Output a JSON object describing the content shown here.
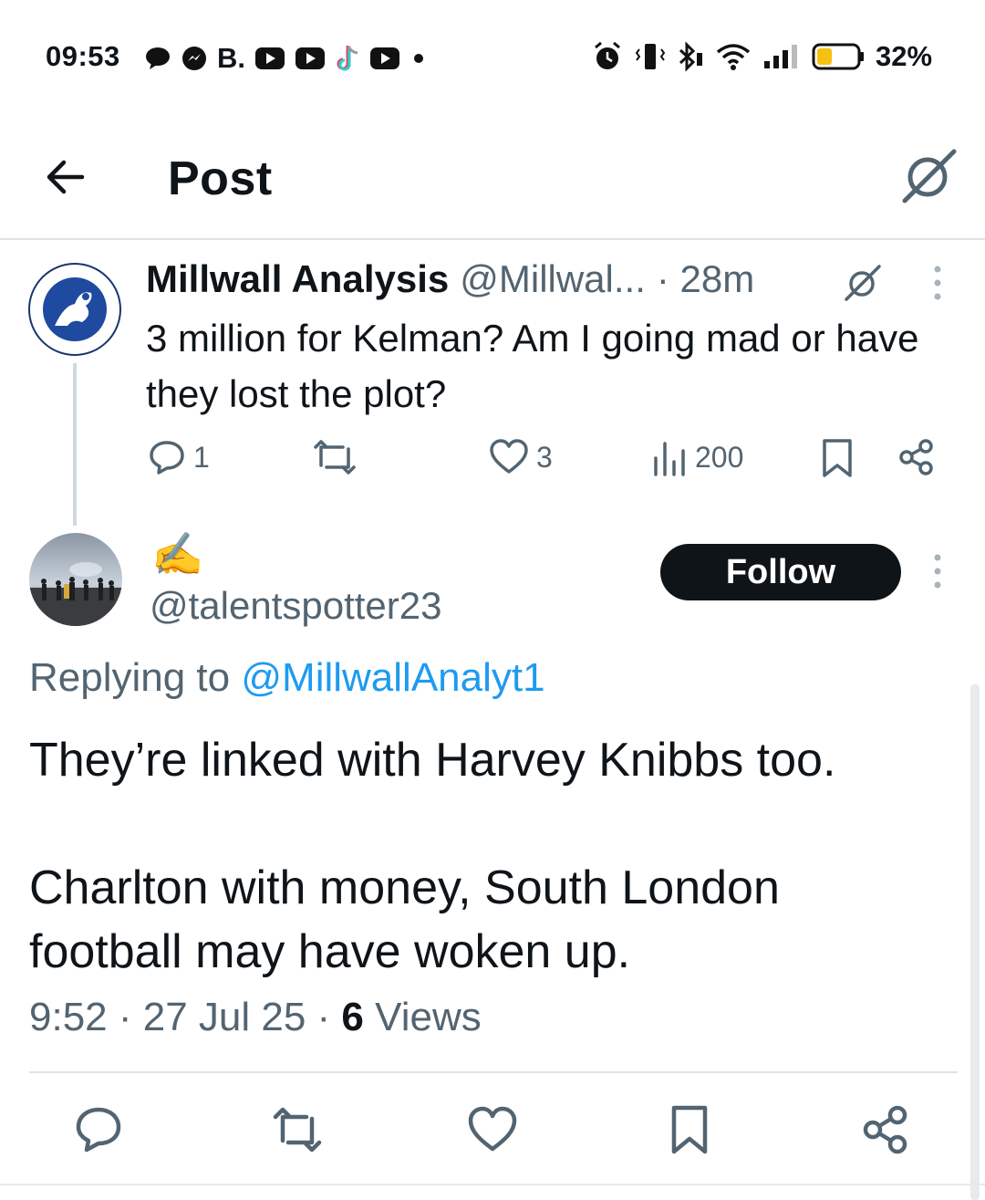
{
  "status_bar": {
    "time": "09:53",
    "b_label": "B.",
    "battery": "32%",
    "left_icons": [
      "message-icon",
      "messenger-icon",
      "b-icon",
      "youtube-icon",
      "youtube-icon",
      "tiktok-icon",
      "youtube-icon",
      "dot-icon"
    ],
    "right_icons": [
      "alarm-icon",
      "vibrate-icon",
      "bluetooth-icon",
      "wifi-icon",
      "signal-icon",
      "battery-icon"
    ]
  },
  "header": {
    "title": "Post",
    "back_icon": "arrow-left-icon",
    "grok_icon": "grok-icon"
  },
  "parent_tweet": {
    "name": "Millwall Analysis",
    "handle": "@Millwal...",
    "time": "· 28m",
    "text": "3 million for Kelman? Am I going mad or have they lost the plot?",
    "replies": "1",
    "likes": "3",
    "views": "200"
  },
  "reply_tweet": {
    "name": "✍️",
    "handle": "@talentspotter23",
    "follow_label": "Follow",
    "replying_prefix": "Replying to",
    "replying_handle": "@MillwallAnalyt1",
    "text": "They’re linked with Harvey Knibbs too.\n\nCharlton with money, South London football may have woken up.",
    "timestamp": "9:52 · 27 Jul 25 · ",
    "views_count": "6",
    "views_label": "Views"
  },
  "colors": {
    "text": "#0f1419",
    "secondary": "#536471",
    "link": "#1d9bf0",
    "divider": "#dfe3e6",
    "battery_fill": "#f5c211"
  }
}
